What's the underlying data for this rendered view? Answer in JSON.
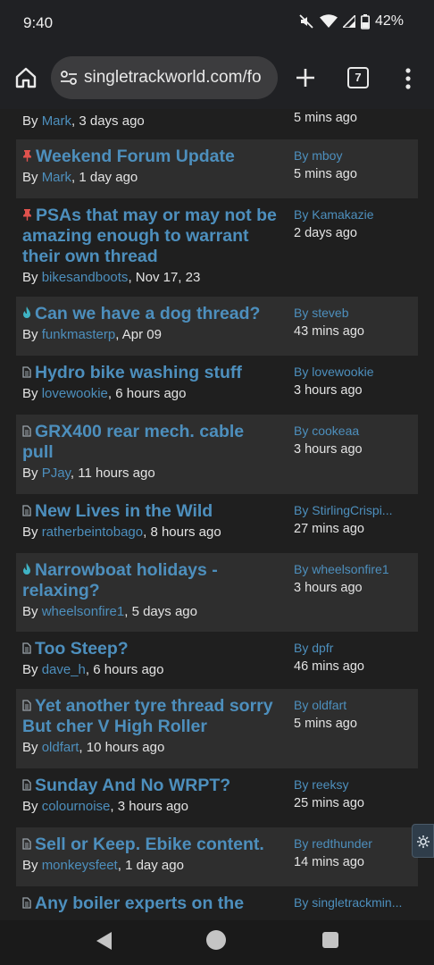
{
  "status": {
    "time": "9:40",
    "battery": "42%"
  },
  "toolbar": {
    "url": "singletrackworld.com/fo",
    "tab_count": "7"
  },
  "partial_top": {
    "byline_prefix": "By ",
    "author": "Mark",
    "ago": ", 3 days ago",
    "last_time": "5 mins ago"
  },
  "threads": [
    {
      "icon": "pin-icon",
      "title": "Weekend Forum Update",
      "author": "Mark",
      "ago": ", 1 day ago",
      "last_by": "By mboy",
      "last_time": "5 mins ago"
    },
    {
      "icon": "pin-icon",
      "title": "PSAs that may or may not be amazing enough to warrant their own thread",
      "author": "bikesandboots",
      "ago": ", Nov 17, 23",
      "last_by": "By Kamakazie",
      "last_time": "2 days ago"
    },
    {
      "icon": "flame-icon",
      "title": "Can we have a dog thread?",
      "author": "funkmasterp",
      "ago": ", Apr 09",
      "last_by": "By steveb",
      "last_time": "43 mins ago"
    },
    {
      "icon": "document-icon",
      "title": "Hydro bike washing stuff",
      "author": "lovewookie",
      "ago": ", 6 hours ago",
      "last_by": "By lovewookie",
      "last_time": "3 hours ago"
    },
    {
      "icon": "document-icon",
      "title": "GRX400 rear mech. cable pull",
      "author": "PJay",
      "ago": ", 11 hours ago",
      "last_by": "By cookeaa",
      "last_time": "3 hours ago"
    },
    {
      "icon": "document-icon",
      "title": "New Lives in the Wild",
      "author": "ratherbeintobago",
      "ago": ", 8 hours ago",
      "last_by": "By StirlingCrispi...",
      "last_time": "27 mins ago"
    },
    {
      "icon": "flame-icon",
      "title": "Narrowboat holidays - relaxing?",
      "author": "wheelsonfire1",
      "ago": ", 5 days ago",
      "last_by": "By wheelsonfire1",
      "last_time": "3 hours ago"
    },
    {
      "icon": "document-icon",
      "title": "Too Steep?",
      "author": "dave_h",
      "ago": ", 6 hours ago",
      "last_by": "By dpfr",
      "last_time": "46 mins ago"
    },
    {
      "icon": "document-icon",
      "title": "Yet another tyre thread sorry But cher V High Roller",
      "author": "oldfart",
      "ago": ", 10 hours ago",
      "last_by": "By oldfart",
      "last_time": "5 mins ago"
    },
    {
      "icon": "document-icon",
      "title": "Sunday And No WRPT?",
      "author": "colournoise",
      "ago": ", 3 hours ago",
      "last_by": "By reeksy",
      "last_time": "25 mins ago"
    },
    {
      "icon": "document-icon",
      "title": "Sell or Keep. Ebike content.",
      "author": "monkeysfeet",
      "ago": ", 1 day ago",
      "last_by": "By redthunder",
      "last_time": "14 mins ago"
    },
    {
      "icon": "document-icon",
      "title": "Any boiler experts on the",
      "author": "",
      "ago": "",
      "last_by": "By singletrackmin...",
      "last_time": ""
    }
  ],
  "byline_prefix": "By ",
  "colors": {
    "link": "#4d8fbd",
    "pin": "#e0524d",
    "flame": "#3fb3c4",
    "row_alt": "#2e2e2e"
  }
}
